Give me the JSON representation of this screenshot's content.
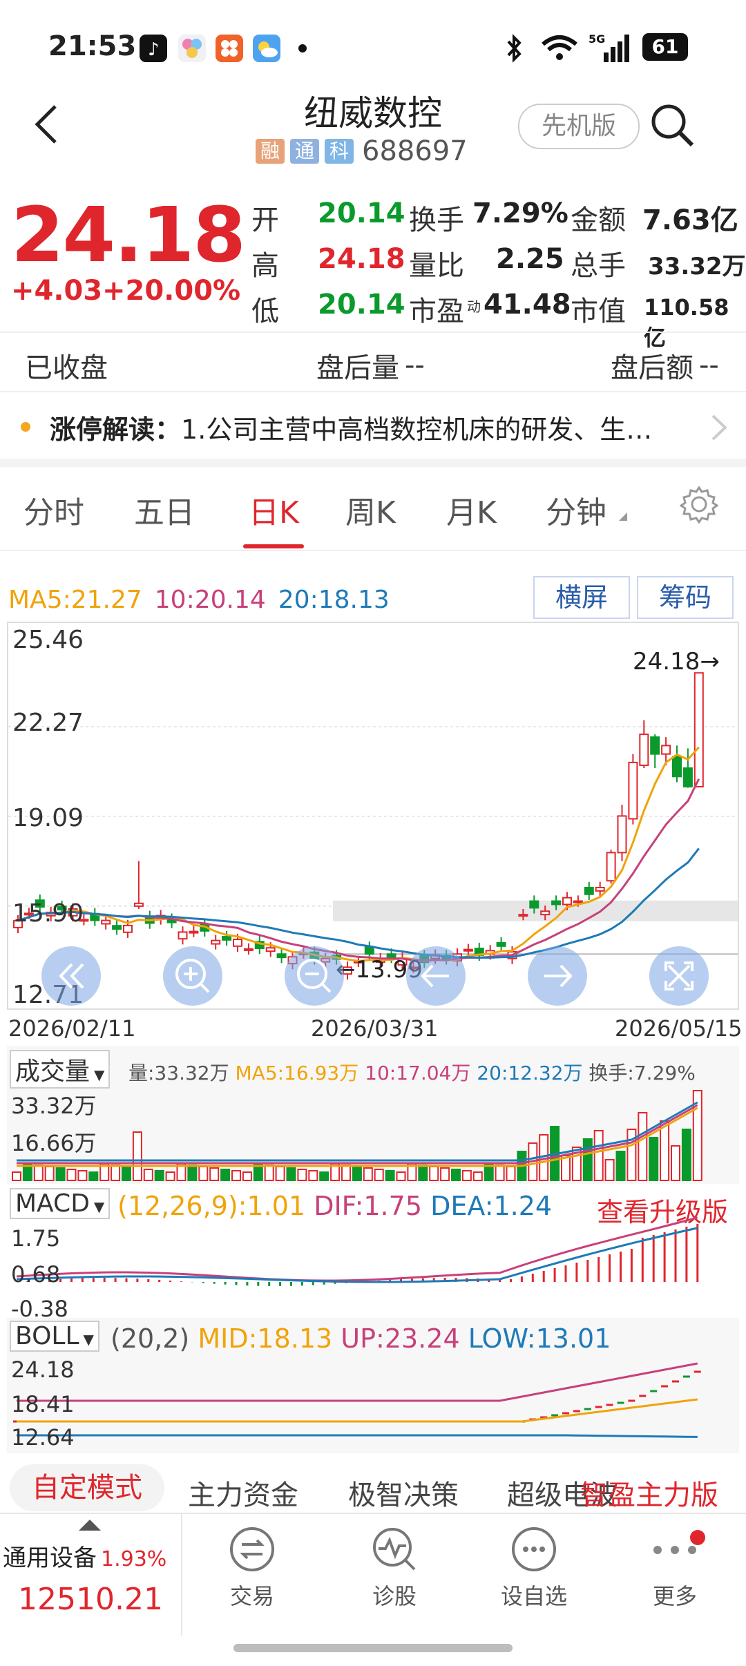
{
  "status_bar": {
    "time": "21:53",
    "battery": "61",
    "signal": "5G"
  },
  "header": {
    "title": "纽威数控",
    "tags": [
      "融",
      "通",
      "科"
    ],
    "code": "688697",
    "pioneer_label": "先机版",
    "colors": {
      "tag_rong": "#e7a279",
      "tag_tong": "#8fb1e0",
      "tag_ke": "#7fb6e6"
    }
  },
  "quote": {
    "price": "24.18",
    "change": "+4.03",
    "change_pct": "+20.00%",
    "fields": {
      "open_label": "开",
      "open": "20.14",
      "high_label": "高",
      "high": "24.18",
      "low_label": "低",
      "low": "20.14",
      "turnover_label": "换手",
      "turnover": "7.29%",
      "vol_ratio_label": "量比",
      "vol_ratio": "2.25",
      "pe_label": "市盈",
      "pe_sup": "动",
      "pe": "41.48",
      "amount_label": "金额",
      "amount": "7.63亿",
      "total_hands_label": "总手",
      "total_hands": "33.32万",
      "mktcap_label": "市值",
      "mktcap": "110.58亿"
    }
  },
  "after_hours": {
    "status": "已收盘",
    "volume_label": "盘后量",
    "volume": "--",
    "amount_label": "盘后额",
    "amount": "--"
  },
  "news": {
    "prefix": "涨停解读：",
    "text": "1.公司主营中高档数控机床的研发、生…"
  },
  "chart_tabs": {
    "items": [
      "分时",
      "五日",
      "日K",
      "周K",
      "月K",
      "分钟"
    ],
    "active": "日K"
  },
  "kline": {
    "ma_legend": {
      "ma5": "MA5:21.27",
      "ma10": "10:20.14",
      "ma20": "20:18.13"
    },
    "buttons": {
      "landscape": "横屏",
      "chips": "筹码"
    },
    "y_labels": [
      "25.46",
      "22.27",
      "19.09",
      "15.90",
      "12.71"
    ],
    "x_labels": [
      "2026/02/11",
      "2026/03/31",
      "2026/05/15"
    ],
    "high_marker": "24.18",
    "low_marker": "13.99"
  },
  "volume_panel": {
    "name": "成交量",
    "vol": "量:33.32万",
    "ma5": "MA5:16.93万",
    "ma10": "10:17.04万",
    "ma20": "20:12.32万",
    "turnover": "换手:7.29%",
    "y_labels": [
      "33.32万",
      "16.66万"
    ]
  },
  "macd_panel": {
    "name": "MACD",
    "params": "(12,26,9):1.01",
    "dif": "DIF:1.75",
    "dea": "DEA:1.24",
    "upgrade": "查看升级版",
    "y_labels": [
      "1.75",
      "0.68",
      "-0.38"
    ]
  },
  "boll_panel": {
    "name": "BOLL",
    "params": "(20,2)",
    "mid": "MID:18.13",
    "up": "UP:23.24",
    "low": "LOW:13.01",
    "y_labels": [
      "24.18",
      "18.41",
      "12.64"
    ]
  },
  "bottom_tabs": {
    "items": [
      "自定模式",
      "主力资金",
      "极智决策",
      "超级电波"
    ],
    "active": "自定模式",
    "promo": "智盈主力版"
  },
  "bottom_nav": {
    "index_name": "通用设备",
    "index_pct": "1.93%",
    "index_value": "12510.21",
    "items": [
      "交易",
      "诊股",
      "设自选",
      "更多"
    ]
  },
  "chart_data": {
    "type": "candlestick",
    "ylim": [
      12.71,
      25.46
    ],
    "candles_recent": [
      {
        "o": 20.14,
        "h": 24.18,
        "l": 20.14,
        "c": 24.18
      },
      {
        "o": 20.8,
        "h": 21.5,
        "l": 20.1,
        "c": 20.14
      },
      {
        "o": 21.2,
        "h": 21.6,
        "l": 20.3,
        "c": 20.5
      },
      {
        "o": 21.3,
        "h": 21.9,
        "l": 20.9,
        "c": 21.6
      },
      {
        "o": 21.9,
        "h": 22.0,
        "l": 20.8,
        "c": 21.3
      },
      {
        "o": 20.9,
        "h": 22.5,
        "l": 20.8,
        "c": 22.0
      },
      {
        "o": 19.0,
        "h": 21.3,
        "l": 18.8,
        "c": 21.0
      },
      {
        "o": 17.8,
        "h": 19.5,
        "l": 17.5,
        "c": 19.1
      },
      {
        "o": 16.8,
        "h": 17.9,
        "l": 16.7,
        "c": 17.8
      }
    ],
    "period_low": 13.99,
    "period_high": 24.18
  }
}
